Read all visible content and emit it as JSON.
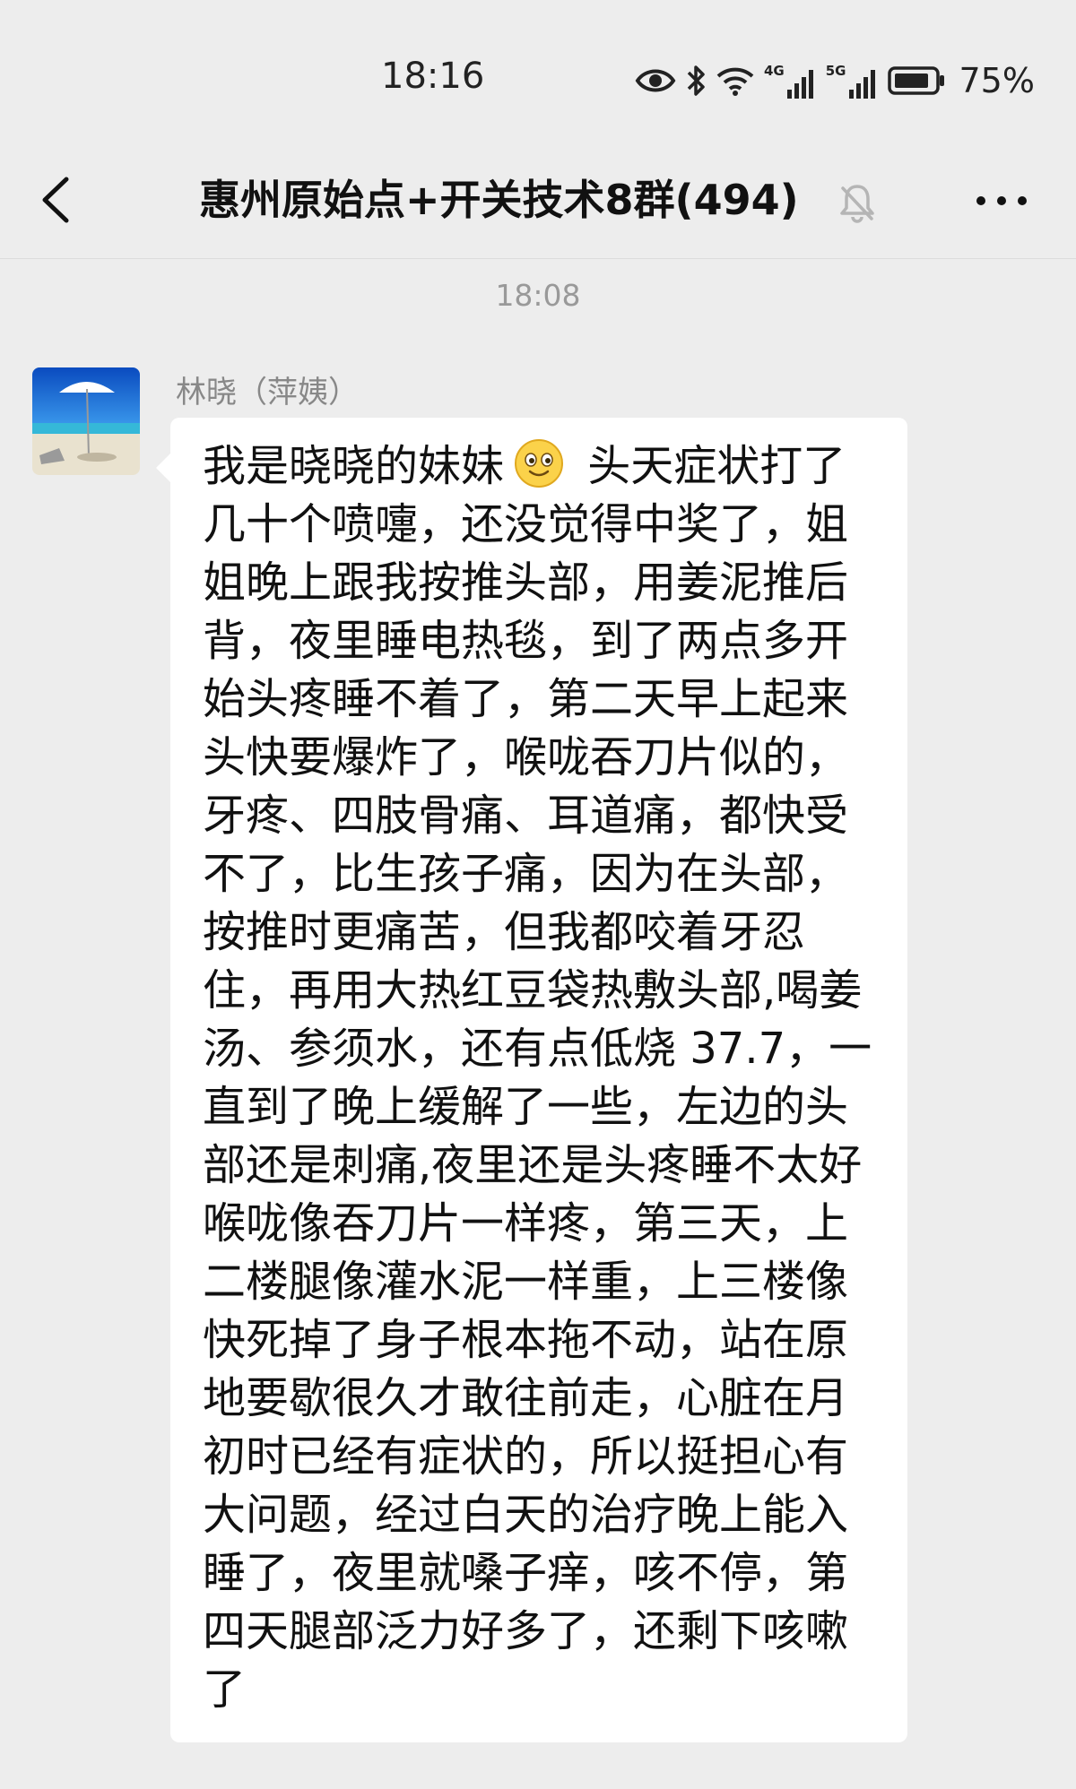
{
  "status_bar": {
    "time": "18:16",
    "network_1": "4G",
    "network_2": "5G",
    "battery": "75%",
    "icons": [
      "eye-icon",
      "bluetooth-icon",
      "wifi-icon",
      "signal-4g-icon",
      "signal-5g-icon",
      "battery-icon"
    ]
  },
  "nav": {
    "back_icon": "chevron-left-icon",
    "title": "惠州原始点+开关技术8群(494)",
    "mute_icon": "bell-muted-icon",
    "more_icon": "more-dots-icon"
  },
  "chat": {
    "timestamp": "18:08",
    "messages": [
      {
        "sender": "林晓（萍姨）",
        "avatar": "beach-umbrella-avatar",
        "text_before_emoji": "我是晓晓的妹妹",
        "emoji": "smile-emoji",
        "text_after_emoji": " 头天症状打了几十个喷嚏，还没觉得中奖了，姐姐晚上跟我按推头部，用姜泥推后背，夜里睡电热毯，到了两点多开始头疼睡不着了，第二天早上起来头快要爆炸了，喉咙吞刀片似的，牙疼、四肢骨痛、耳道痛，都快受不了，比生孩子痛，因为在头部，按推时更痛苦，但我都咬着牙忍住，再用大热红豆袋热敷头部,喝姜汤、参须水，还有点低烧 37.7，一直到了晚上缓解了一些，左边的头部还是刺痛,夜里还是头疼睡不太好喉咙像吞刀片一样疼，第三天，上二楼腿像灌水泥一样重，上三楼像快死掉了身子根本拖不动，站在原地要歇很久才敢往前走，心脏在月初时已经有症状的，所以挺担心有大问题，经过白天的治疗晚上能入睡了，夜里就嗓子痒，咳不停，第四天腿部泛力好多了，还剩下咳嗽了"
      }
    ]
  }
}
